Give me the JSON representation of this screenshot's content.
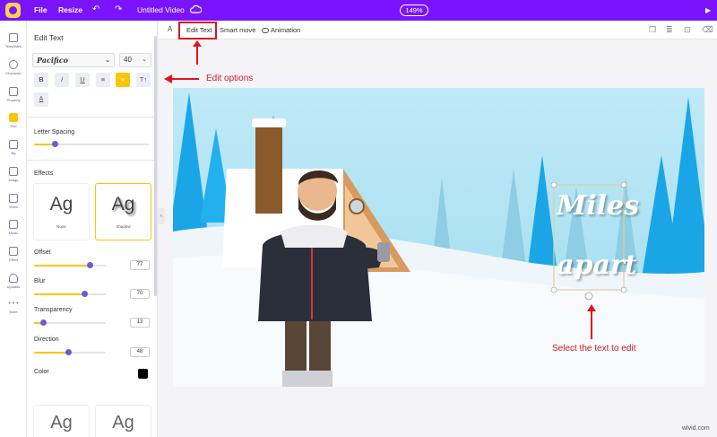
{
  "topbar": {
    "file_label": "File",
    "resize_label": "Resize",
    "undo_icon": "undo-icon",
    "redo_icon": "redo-icon",
    "title": "Untitled Video",
    "zoom": "149%",
    "accent_color": "#7a14ff"
  },
  "iconbar": {
    "items": [
      {
        "label": "Templates",
        "icon": "templates-icon"
      },
      {
        "label": "Character",
        "icon": "character-icon"
      },
      {
        "label": "Property",
        "icon": "property-icon"
      },
      {
        "label": "Text",
        "icon": "text-icon",
        "active": true
      },
      {
        "label": "Bg",
        "icon": "background-icon"
      },
      {
        "label": "Image",
        "icon": "image-icon"
      },
      {
        "label": "Video",
        "icon": "video-icon"
      },
      {
        "label": "Music",
        "icon": "music-icon"
      },
      {
        "label": "Effect",
        "icon": "effect-icon"
      },
      {
        "label": "Uploads",
        "icon": "uploads-icon"
      },
      {
        "label": "More",
        "icon": "more-icon"
      }
    ]
  },
  "panel": {
    "title": "Edit Text",
    "font_family": "Pacifico",
    "font_size": "40",
    "format_buttons": {
      "bold": "B",
      "italic": "I",
      "underline": "U",
      "list": "≡",
      "align": "≡",
      "case": "T↑",
      "color": "A"
    },
    "letter_spacing_label": "Letter Spacing",
    "letter_spacing_level": 0.18,
    "effects_label": "Effects",
    "effects": [
      {
        "sample": "Ag",
        "name": "None"
      },
      {
        "sample": "Ag",
        "name": "Shadow",
        "selected": true
      }
    ],
    "offset_label": "Offset",
    "offset_value": "77",
    "blur_label": "Blur",
    "blur_value": "70",
    "transparency_label": "Transparency",
    "transparency_value": "13",
    "direction_label": "Direction",
    "direction_value": "48",
    "color_label": "Color",
    "shadow_color": "#000000",
    "presets": [
      {
        "sample": "Ag"
      },
      {
        "sample": "Ag"
      }
    ]
  },
  "toolbar": {
    "text_icon_label": "A",
    "edit_text_label": "Edit Text",
    "smart_move_label": "Smart move",
    "animation_label": "Animation",
    "right_icons": [
      "copy-icon",
      "layers-icon",
      "lock-icon",
      "delete-icon"
    ]
  },
  "canvas": {
    "text_line1": "Miles",
    "text_line2": "apart"
  },
  "annotations": {
    "edit_options": "Edit options",
    "select_text": "Select the text to edit",
    "highlight_color": "#e0131f"
  },
  "watermark": "wlvid.com"
}
